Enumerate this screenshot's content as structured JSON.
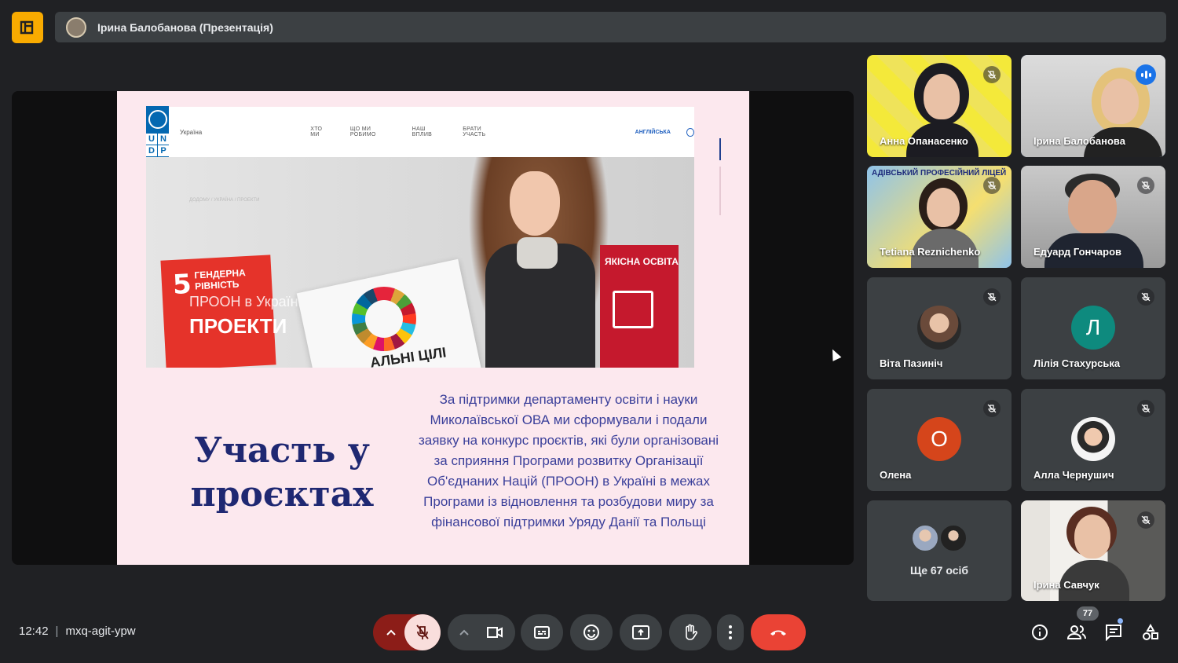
{
  "header": {
    "presenter_title": "Ірина Балобанова (Презентація)"
  },
  "slide": {
    "site": {
      "country": "Україна",
      "menu": [
        "ХТО МИ",
        "ЩО МИ РОБИМО",
        "НАШ ВПЛИВ",
        "БРАТИ УЧАСТЬ"
      ],
      "language": "АНГЛІЙСЬКА",
      "breadcrumb": "ДОДОМУ / УКРАЇНА / ПРОЕКТИ",
      "cube_left_number": "5",
      "cube_left_text": "ГЕНДЕРНА РІВНІСТЬ",
      "overlay_line1": "ПРООН в Україні",
      "overlay_line2": "ПРОЕКТИ",
      "card_text": "АЛЬНІ ЦІЛІ",
      "cube_right_text": "ЯКІСНА ОСВІТА"
    },
    "heading": "Участь у проєктах",
    "body": "За підтримки департаменту освіти і науки Миколаївської ОВА ми сформували і подали заявку на конкурс проєктів, які були організовані за сприяння Програми розвитку Організації Об'єднаних Націй (ПРООН) в Україні в межах Програми із відновлення та розбудови миру за фінансової підтримки Уряду Данії та Польщі"
  },
  "participants": [
    {
      "name": "Анна Опанасенко",
      "muted": true,
      "type": "video"
    },
    {
      "name": "Ірина Балобанова",
      "muted": false,
      "speaking": true,
      "type": "video"
    },
    {
      "name": "Tetiana Reznichenko",
      "muted": true,
      "type": "video",
      "banner": "АДІВСЬКИЙ ПРОФЕСІЙНИЙ ЛІЦЕЙ"
    },
    {
      "name": "Едуард Гончаров",
      "muted": true,
      "type": "video"
    },
    {
      "name": "Віта Пазиніч",
      "muted": true,
      "type": "photo"
    },
    {
      "name": "Лілія Стахурська",
      "muted": true,
      "type": "initial",
      "initial": "Л",
      "color": "#0e8a7e"
    },
    {
      "name": "Олена",
      "muted": true,
      "type": "initial",
      "initial": "О",
      "color": "#d5451b"
    },
    {
      "name": "Алла Чернушич",
      "muted": true,
      "type": "photo"
    },
    {
      "name": "Ще 67 осіб",
      "type": "more"
    },
    {
      "name": "Ірина Савчук",
      "muted": true,
      "type": "video"
    }
  ],
  "footer": {
    "time": "12:42",
    "separator": "|",
    "meeting_code": "mxq-agit-ypw",
    "participants_count": "77"
  },
  "colors": {
    "background": "#202124",
    "end_call": "#ea4335",
    "mic_muted_bg": "#f9dedc",
    "logo": "#f9ab00"
  },
  "icons": [
    "meet-logo-icon",
    "chevron-up-icon",
    "mic-off-icon",
    "camera-icon",
    "captions-icon",
    "emoji-icon",
    "present-icon",
    "raise-hand-icon",
    "more-vert-icon",
    "end-call-icon",
    "info-icon",
    "people-icon",
    "chat-icon",
    "activities-icon"
  ]
}
